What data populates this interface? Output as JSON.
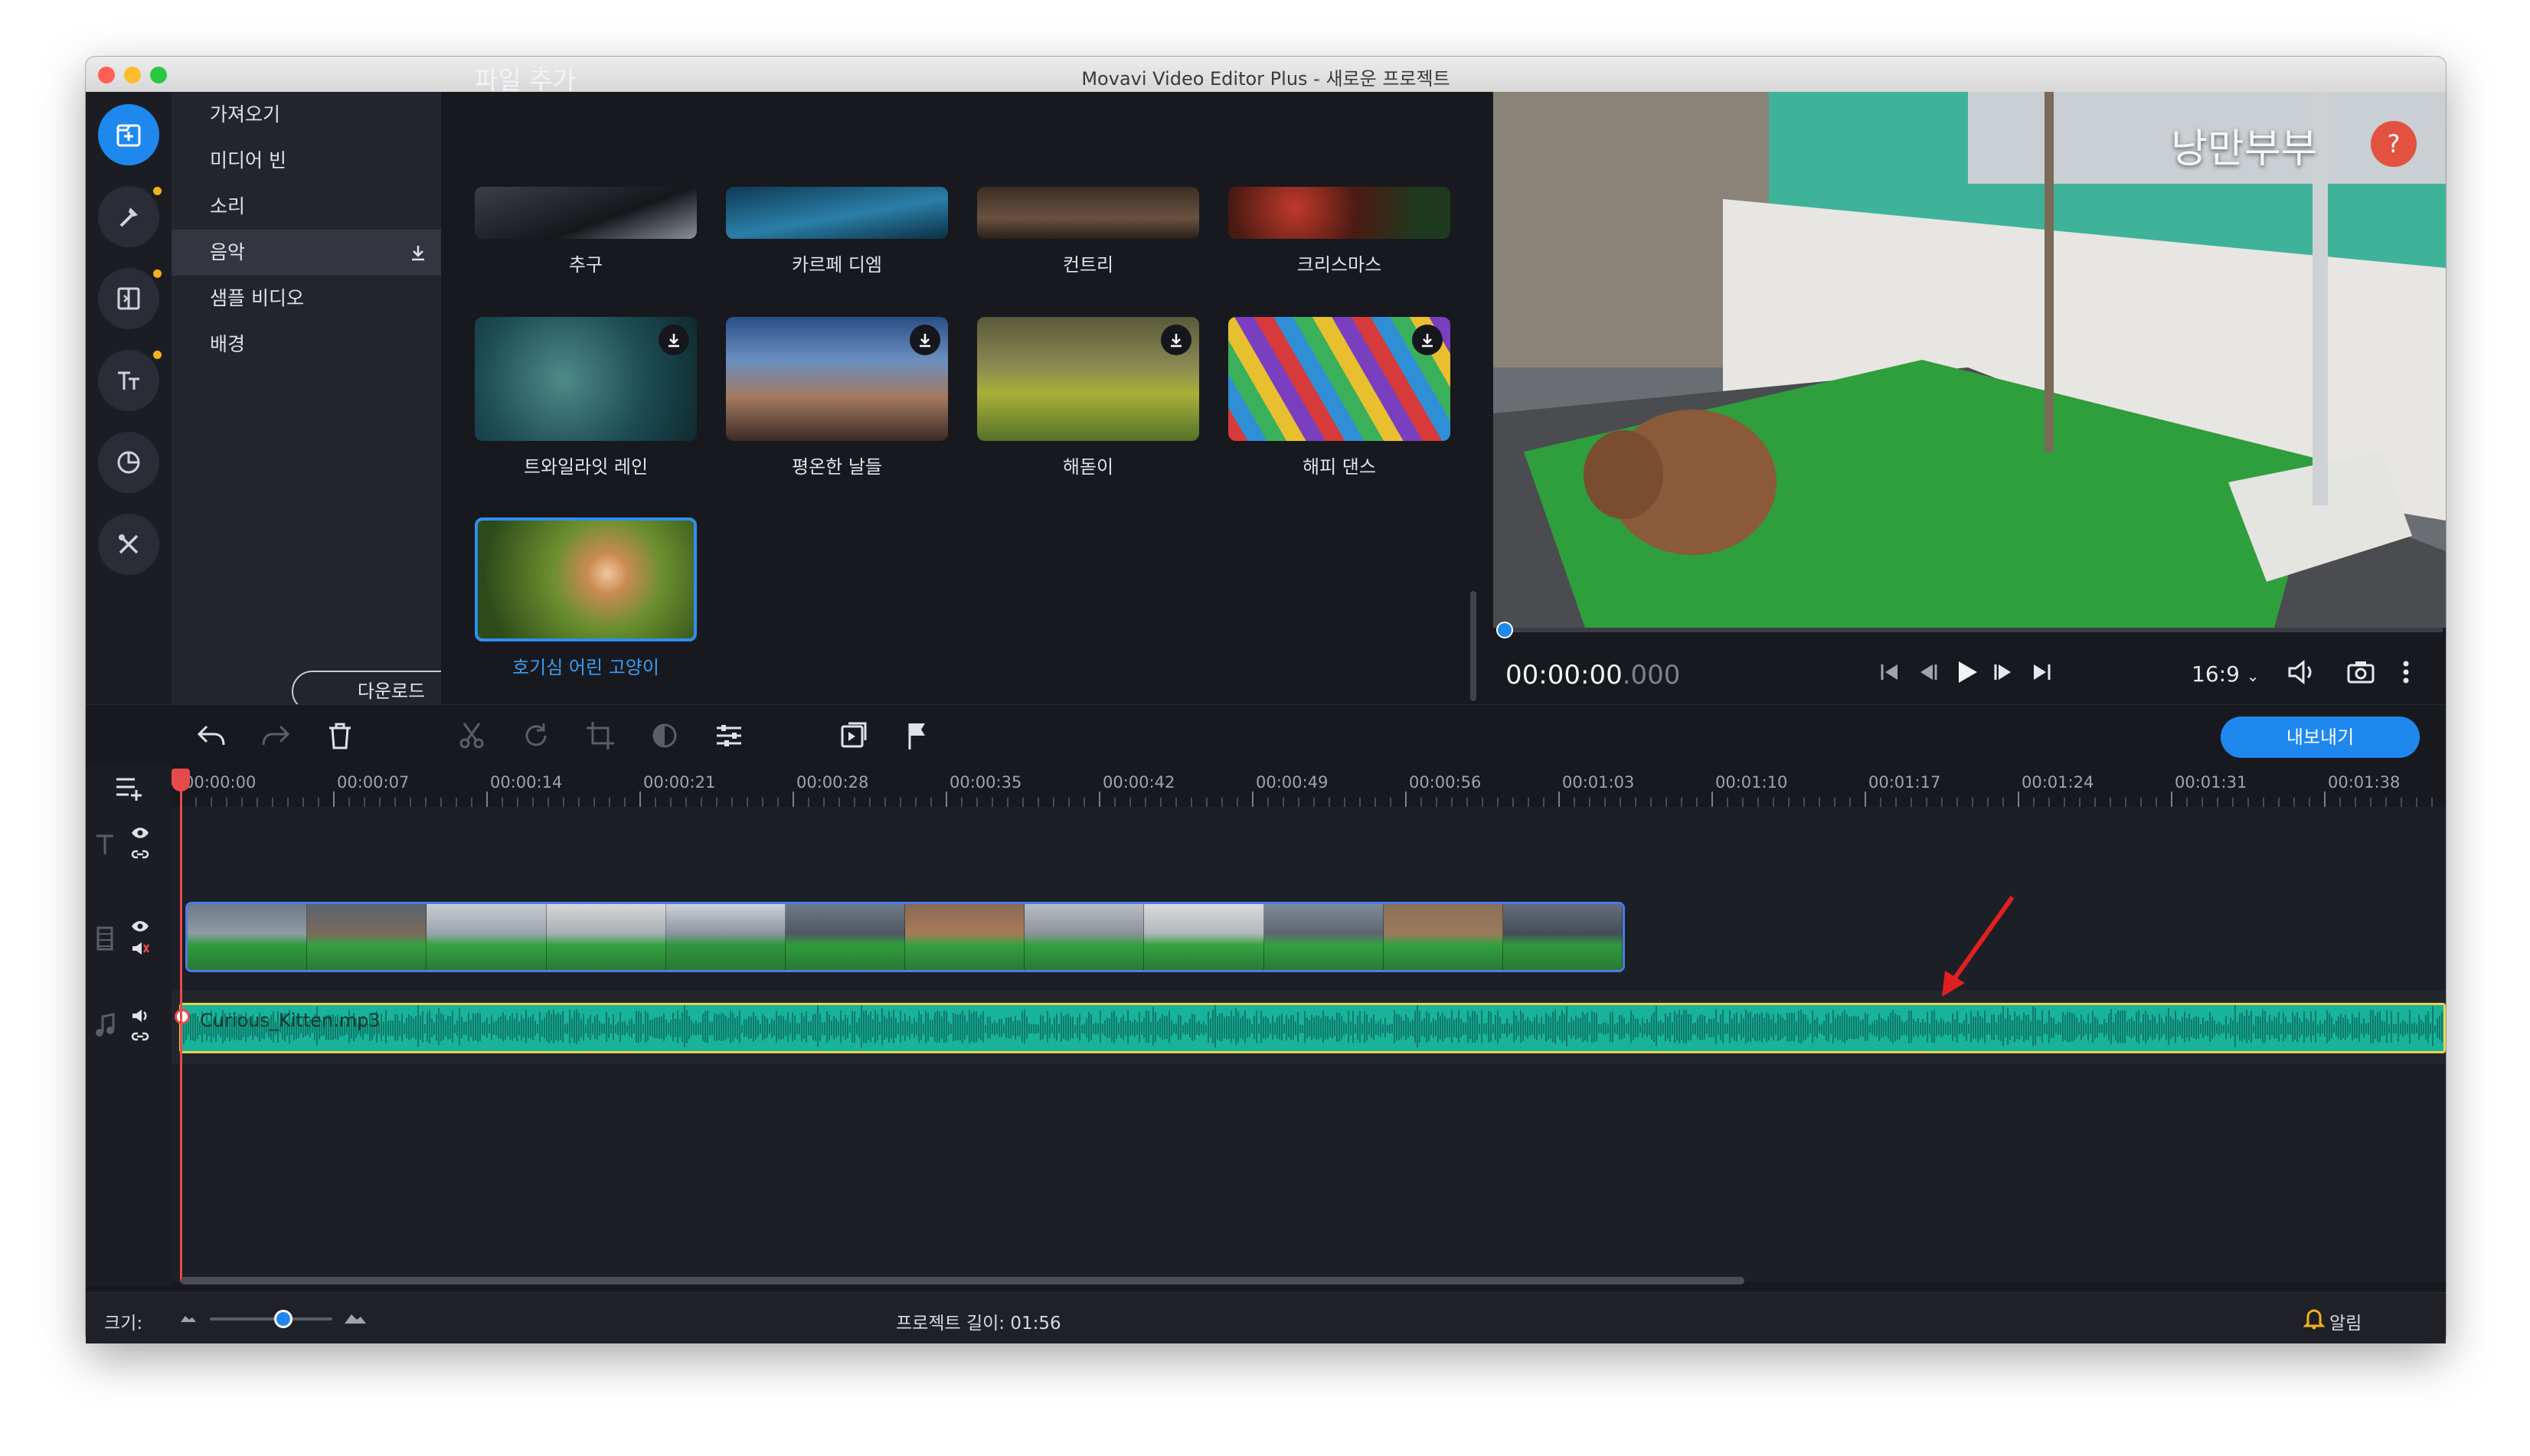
{
  "window": {
    "title": "Movavi Video Editor Plus - 새로운 프로젝트",
    "traffic_colors": [
      "#fe5f57",
      "#febc2e",
      "#28c840"
    ]
  },
  "rail": {
    "buttons": [
      "import-icon",
      "magic-pin-icon",
      "transitions-icon",
      "titles-icon",
      "stickers-icon",
      "tools-icon"
    ],
    "accent": "#1e88ee"
  },
  "categories": {
    "items": [
      {
        "label": "가져오기"
      },
      {
        "label": "미디어 빈"
      },
      {
        "label": "소리"
      },
      {
        "label": "음악"
      },
      {
        "label": "샘플 비디오"
      },
      {
        "label": "배경"
      }
    ],
    "active_index": 3,
    "download_label": "다운로드"
  },
  "library": {
    "title": "파일 추가",
    "row1": [
      {
        "label": "추구"
      },
      {
        "label": "카르페 디엠"
      },
      {
        "label": "컨트리"
      },
      {
        "label": "크리스마스"
      }
    ],
    "row2": [
      {
        "label": "트와일라잇 레인"
      },
      {
        "label": "평온한 날들"
      },
      {
        "label": "해돋이"
      },
      {
        "label": "해피 댄스"
      }
    ],
    "row3": [
      {
        "label": "호기심 어린 고양이",
        "selected": true
      }
    ]
  },
  "preview": {
    "watermark": "낭만부부",
    "help": "?",
    "timecode_main": "00:00:00",
    "timecode_ms": ".000",
    "aspect": "16:9",
    "progress": 0.0
  },
  "toolbar": {
    "export_label": "내보내기"
  },
  "timeline": {
    "ticks": [
      "00:00:00",
      "00:00:07",
      "00:00:14",
      "00:00:21",
      "00:00:28",
      "00:00:35",
      "00:00:42",
      "00:00:49",
      "00:00:56",
      "00:01:03",
      "00:01:10",
      "00:01:17",
      "00:01:24",
      "00:01:31",
      "00:01:38"
    ],
    "audio_clip_name": "Curious_Kitten.mp3",
    "colors": {
      "audio": "#18b39b",
      "audio_border": "#e9d34a",
      "video_border": "#4a7be8",
      "playhead": "#e74a4a",
      "annotation_arrow": "#e02020"
    }
  },
  "status": {
    "size_label": "크기:",
    "project_length_label": "프로젝트 길이:",
    "project_length_value": "01:56",
    "notifications_label": "알림",
    "zoom_level": 0.6
  }
}
